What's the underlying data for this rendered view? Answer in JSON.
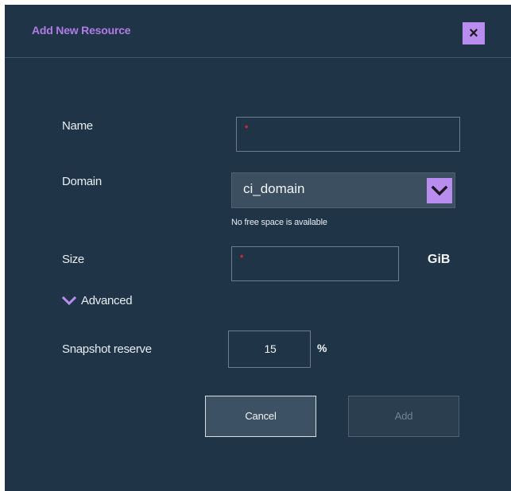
{
  "dialog": {
    "title": "Add New Resource",
    "close_icon": "close-icon",
    "close_glyph": "×"
  },
  "form": {
    "name": {
      "label": "Name",
      "value": "",
      "required_marker": "*"
    },
    "domain": {
      "label": "Domain",
      "selected": "ci_domain",
      "helper": "No free space is available",
      "arrow_icon": "chevron-down-icon"
    },
    "size": {
      "label": "Size",
      "value": "",
      "required_marker": "*",
      "unit": "GiB"
    },
    "advanced": {
      "label": "Advanced",
      "icon": "chevron-down-icon",
      "expanded": true
    },
    "snapshot_reserve": {
      "label": "Snapshot reserve",
      "value": "15",
      "unit": "%"
    }
  },
  "buttons": {
    "cancel": "Cancel",
    "add": "Add",
    "add_disabled": true
  },
  "colors": {
    "panel_bg": "#1f3447",
    "accent": "#b98cf0",
    "title": "#b07ce6",
    "required": "#e0292f"
  }
}
